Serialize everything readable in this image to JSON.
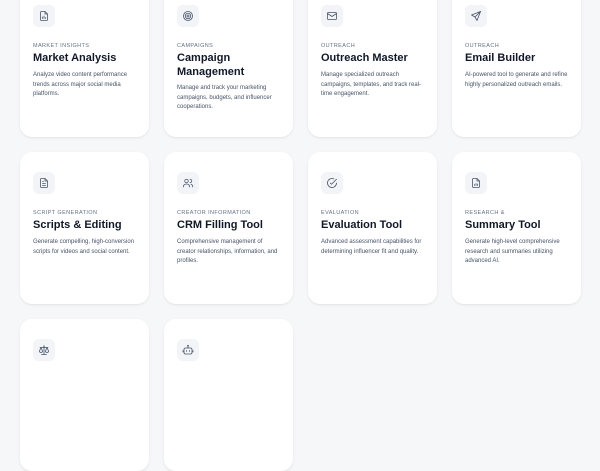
{
  "cards": [
    {
      "icon": "document-chart-icon",
      "category": "MARKET INSIGHTS",
      "title": "Market Analysis",
      "description": "Analyze video content performance trends across major social media platforms."
    },
    {
      "icon": "target-icon",
      "category": "CAMPAIGNS",
      "title": "Campaign Management",
      "description": "Manage and track your marketing campaigns, budgets, and influencer cooperations."
    },
    {
      "icon": "mail-icon",
      "category": "OUTREACH",
      "title": "Outreach Master",
      "description": "Manage specialized outreach campaigns, templates, and track real-time engagement."
    },
    {
      "icon": "send-icon",
      "category": "OUTREACH",
      "title": "Email Builder",
      "description": "AI-powered tool to generate and refine highly personalized outreach emails."
    },
    {
      "icon": "file-text-icon",
      "category": "SCRIPT GENERATION",
      "title": "Scripts & Editing",
      "description": "Generate compelling, high-conversion scripts for videos and social content."
    },
    {
      "icon": "users-icon",
      "category": "CREATOR INFORMATION",
      "title": "CRM Filling Tool",
      "description": "Comprehensive management of creator relationships, information, and profiles."
    },
    {
      "icon": "check-circle-icon",
      "category": "EVALUATION",
      "title": "Evaluation Tool",
      "description": "Advanced assessment capabilities for determining influencer fit and quality."
    },
    {
      "icon": "summary-document-icon",
      "category": "RESEARCH &",
      "title": "Summary Tool",
      "description": "Generate high-level comprehensive research and summaries utilizing advanced AI."
    },
    {
      "icon": "scale-icon",
      "category": "",
      "title": "",
      "description": ""
    },
    {
      "icon": "bot-icon",
      "category": "",
      "title": "",
      "description": ""
    }
  ]
}
